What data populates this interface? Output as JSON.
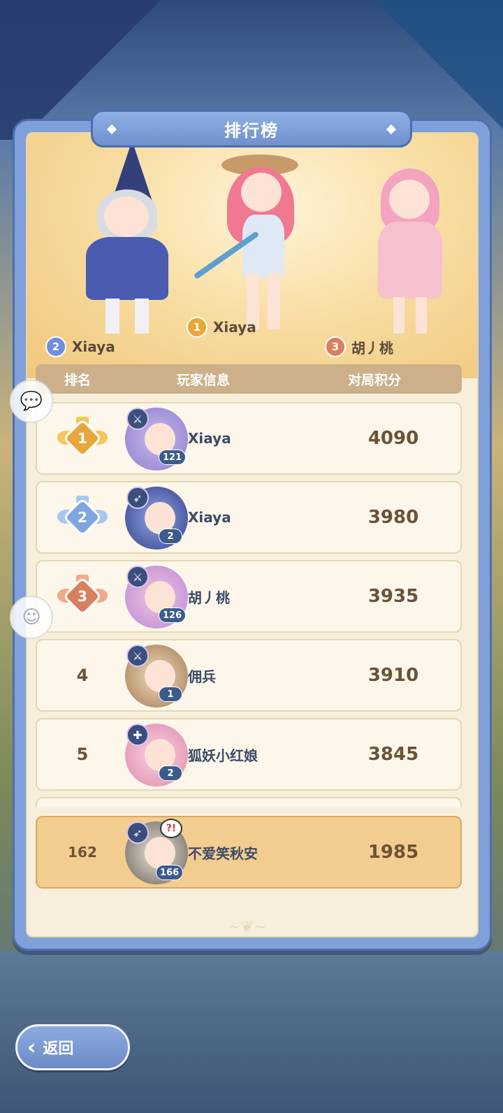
{
  "title": "排行榜",
  "podium": [
    {
      "place": "2",
      "name": "Xiaya",
      "color": "#6f8fd8"
    },
    {
      "place": "1",
      "name": "Xiaya",
      "color": "#e8a73a"
    },
    {
      "place": "3",
      "name": "胡丿桃",
      "color": "#d98060"
    }
  ],
  "table": {
    "headers": {
      "rank": "排名",
      "player": "玩家信息",
      "score": "对局积分"
    }
  },
  "rows": [
    {
      "rank": "1",
      "name": "Xiaya",
      "level": "121",
      "score": "4090",
      "medal": "gold"
    },
    {
      "rank": "2",
      "name": "Xiaya",
      "level": "2",
      "score": "3980",
      "medal": "silver"
    },
    {
      "rank": "3",
      "name": "胡丿桃",
      "level": "126",
      "score": "3935",
      "medal": "bronze"
    },
    {
      "rank": "4",
      "name": "佣兵",
      "level": "1",
      "score": "3910"
    },
    {
      "rank": "5",
      "name": "狐妖小红娘",
      "level": "2",
      "score": "3845"
    }
  ],
  "me": {
    "rank": "162",
    "name": "不爱笑秋安",
    "level": "166",
    "score": "1985",
    "badge": "?!"
  },
  "back_label": "返回",
  "icons": {
    "chat": "chat-bubble-icon",
    "robot": "robot-icon",
    "back": "back-arrow-icon"
  },
  "colors": {
    "gold": "#e8a73a",
    "silver": "#7fa6e0",
    "bronze": "#d98060",
    "panel": "#7fa0d8",
    "my_row": "#f3cd8f"
  }
}
